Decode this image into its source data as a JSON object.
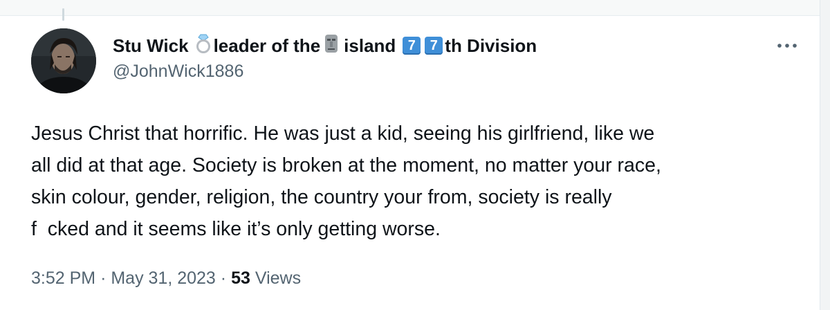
{
  "tweet": {
    "author": {
      "name_parts": {
        "part1": "Stu Wick",
        "part2": "leader of the",
        "part3": "island",
        "keycap1": "7",
        "keycap2": "7",
        "part4": "th Division"
      },
      "handle": "@JohnWick1886"
    },
    "text_lines": [
      "Jesus Christ that horrific. He was just a kid, seeing his girlfriend, like we",
      "all did at that age. Society is broken at the moment, no matter your race,",
      "skin colour, gender, religion, the country your from, society is really",
      "f  cked and it seems like it’s only getting worse."
    ],
    "time": "3:52 PM",
    "separator": "·",
    "date": "May 31, 2023",
    "views_count": "53",
    "views_label": "Views"
  },
  "icons": {
    "ring": "ring-icon",
    "moai": "moai-icon",
    "more": "more-horizontal-icon"
  },
  "colors": {
    "text_primary": "#0f1419",
    "text_secondary": "#536471",
    "keycap_blue": "#3f8fd8"
  }
}
